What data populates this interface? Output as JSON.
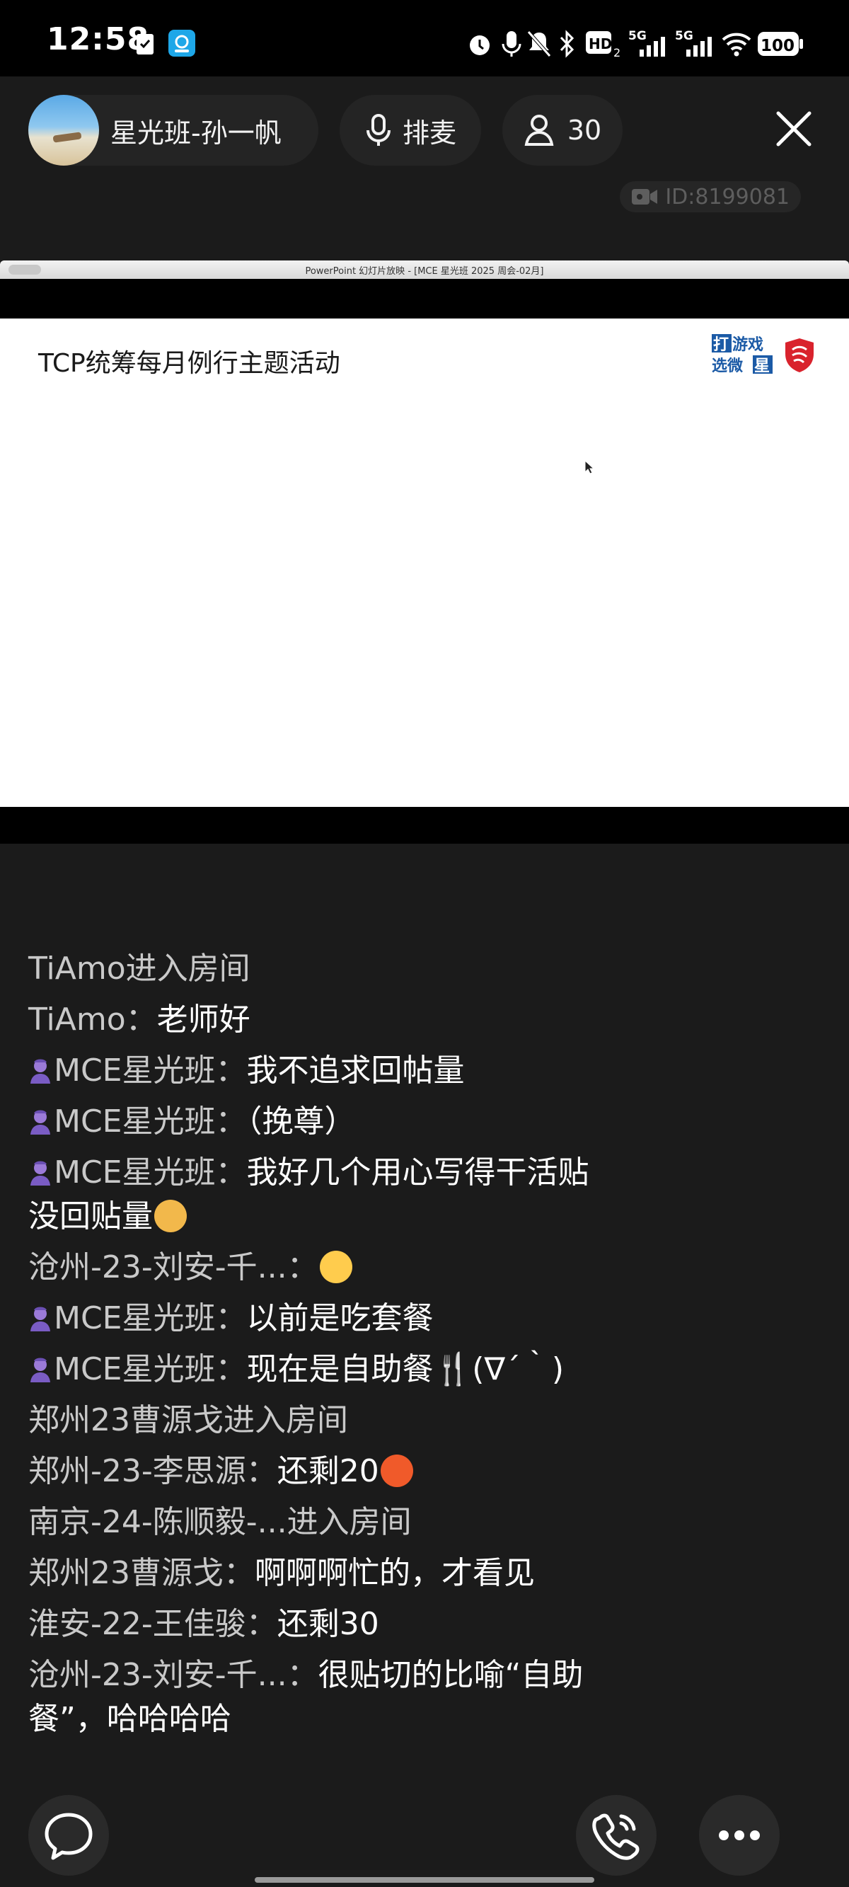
{
  "status_bar": {
    "time": "12:58",
    "icons": [
      "clipboard-icon",
      "app-icon",
      "alarm-icon",
      "mic-icon",
      "mute-icon",
      "bluetooth-icon",
      "hd-icon",
      "signal-5g-icon",
      "signal-5g-icon",
      "wifi-icon",
      "battery-icon"
    ],
    "battery": "100"
  },
  "header": {
    "room_name": "星光班-孙一帆",
    "queue_label": "排麦",
    "audience_count": "30",
    "room_id": "ID:8199081"
  },
  "slideshow": {
    "window_title": "PowerPoint 幻灯片放映 - [MCE 星光班 2025 周会-02月]",
    "slide_title": "TCP统筹每月例行主题活动",
    "logo_lines": [
      "打游戏",
      "选微星"
    ]
  },
  "chat": [
    {
      "name": "TiAmo进入房间",
      "sep": "",
      "content": "",
      "badge": false,
      "emoji": "",
      "system": true
    },
    {
      "name": "TiAmo",
      "sep": "：",
      "content": "老师好",
      "badge": false,
      "emoji": "",
      "system": false
    },
    {
      "name": "MCE星光班",
      "sep": "：",
      "content": "我不追求回帖量",
      "badge": true,
      "emoji": "",
      "system": false
    },
    {
      "name": "MCE星光班",
      "sep": "：",
      "content": "（挽尊）",
      "badge": true,
      "emoji": "",
      "system": false
    },
    {
      "name": "MCE星光班",
      "sep": "：",
      "content": "我好几个用心写得干活贴没回贴量",
      "badge": true,
      "emoji": "sad",
      "system": false
    },
    {
      "name": "沧州-23-刘安-千...",
      "sep": "：",
      "content": "",
      "badge": false,
      "emoji": "relieved",
      "system": false
    },
    {
      "name": "MCE星光班",
      "sep": "：",
      "content": "以前是吃套餐",
      "badge": true,
      "emoji": "",
      "system": false
    },
    {
      "name": "MCE星光班",
      "sep": "：",
      "content": "现在是自助餐🍴(∇´｀)",
      "badge": true,
      "emoji": "",
      "system": false
    },
    {
      "name": "郑州23曹源戈进入房间",
      "sep": "",
      "content": "",
      "badge": false,
      "emoji": "",
      "system": true
    },
    {
      "name": "郑州-23-李思源",
      "sep": "：",
      "content": "还剩20",
      "badge": false,
      "emoji": "angry",
      "system": false
    },
    {
      "name": "南京-24-陈顺毅-...进入房间",
      "sep": "",
      "content": "",
      "badge": false,
      "emoji": "",
      "system": true
    },
    {
      "name": "郑州23曹源戈",
      "sep": "：",
      "content": "啊啊啊忙的，才看见",
      "badge": false,
      "emoji": "",
      "system": false
    },
    {
      "name": "淮安-22-王佳骏",
      "sep": "：",
      "content": "还剩30",
      "badge": false,
      "emoji": "",
      "system": false
    },
    {
      "name": "沧州-23-刘安-千...",
      "sep": "：",
      "content": "很贴切的比喻“自助餐”，哈哈哈哈",
      "badge": false,
      "emoji": "",
      "system": false
    }
  ],
  "bottom_bar": {
    "icons": [
      "chat-bubble-icon",
      "phone-icon",
      "more-icon"
    ]
  }
}
